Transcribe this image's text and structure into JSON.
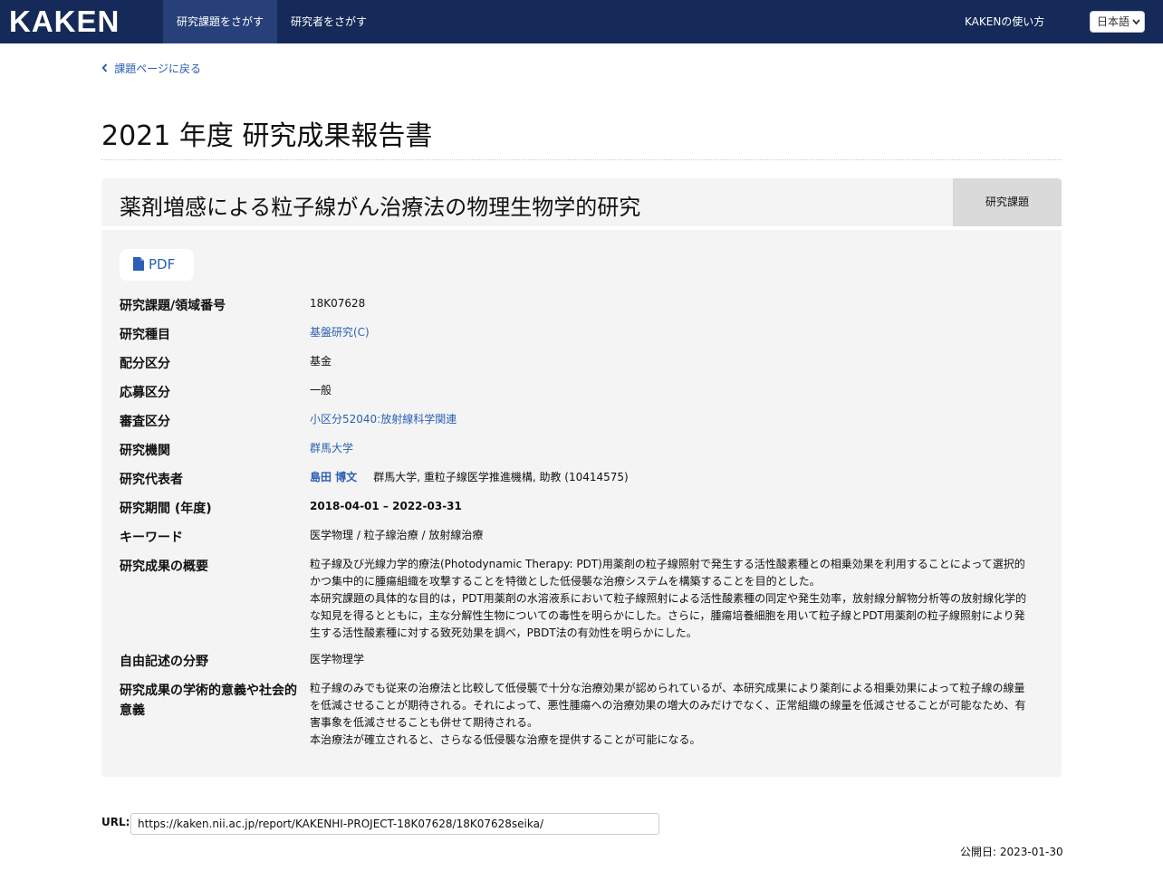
{
  "navbar": {
    "brand": "KAKEN",
    "nav_items": [
      "研究課題をさがす",
      "研究者をさがす"
    ],
    "help_link": "KAKENの使い方",
    "language": "日本語"
  },
  "back_link": "課題ページに戻る",
  "page_title": "2021 年度 研究成果報告書",
  "project": {
    "title": "薬剤増感による粒子線がん治療法の物理生物学的研究",
    "tag": "研究課題"
  },
  "pdf_button": "PDF",
  "details": {
    "project_number_label": "研究課題/領域番号",
    "project_number": "18K07628",
    "research_category_label": "研究種目",
    "research_category": "基盤研究(C)",
    "allocation_label": "配分区分",
    "allocation": "基金",
    "application_label": "応募区分",
    "application": "一般",
    "review_section_label": "審査区分",
    "review_section": "小区分52040:放射線科学関連",
    "institution_label": "研究機関",
    "institution": "群馬大学",
    "representative_label": "研究代表者",
    "representative_name": "島田 博文",
    "representative_affiliation": "群馬大学, 重粒子線医学推進機構, 助教 (10414575)",
    "period_label": "研究期間 (年度)",
    "period": "2018-04-01 – 2022-03-31",
    "keywords_label": "キーワード",
    "keywords": "医学物理 / 粒子線治療 / 放射線治療",
    "summary_label": "研究成果の概要",
    "summary_p1": "粒子線及び光線力学的療法(Photodynamic Therapy: PDT)用薬剤の粒子線照射で発生する活性酸素種との相乗効果を利用することによって選択的かつ集中的に腫瘍組織を攻撃することを特徴とした低侵襲な治療システムを構築することを目的とした。",
    "summary_p2": "本研究課題の具体的な目的は，PDT用薬剤の水溶液系において粒子線照射による活性酸素種の同定や発生効率，放射線分解物分析等の放射線化学的な知見を得るとともに，主な分解性生物についての毒性を明らかにした。さらに，腫瘍培養細胞を用いて粒子線とPDT用薬剤の粒子線照射により発生する活性酸素種に対する致死効果を調べ，PBDT法の有効性を明らかにした。",
    "free_field_label": "自由記述の分野",
    "free_field": "医学物理学",
    "significance_label": "研究成果の学術的意義や社会的意義",
    "significance_p1": "粒子線のみでも従来の治療法と比較して低侵襲で十分な治療効果が認められているが、本研究成果により薬剤による相乗効果によって粒子線の線量を低減させることが期待される。それによって、悪性腫瘍への治療効果の増大のみだけでなく、正常組織の線量を低減させることが可能なため、有害事象を低減させることも併せて期待される。",
    "significance_p2": "本治療法が確立されると、さらなる低侵襲な治療を提供することが可能になる。"
  },
  "footer": {
    "url_label": "URL:",
    "url": "https://kaken.nii.ac.jp/report/KAKENHI-PROJECT-18K07628/18K07628seika/",
    "published": "公開日: 2023-01-30"
  }
}
